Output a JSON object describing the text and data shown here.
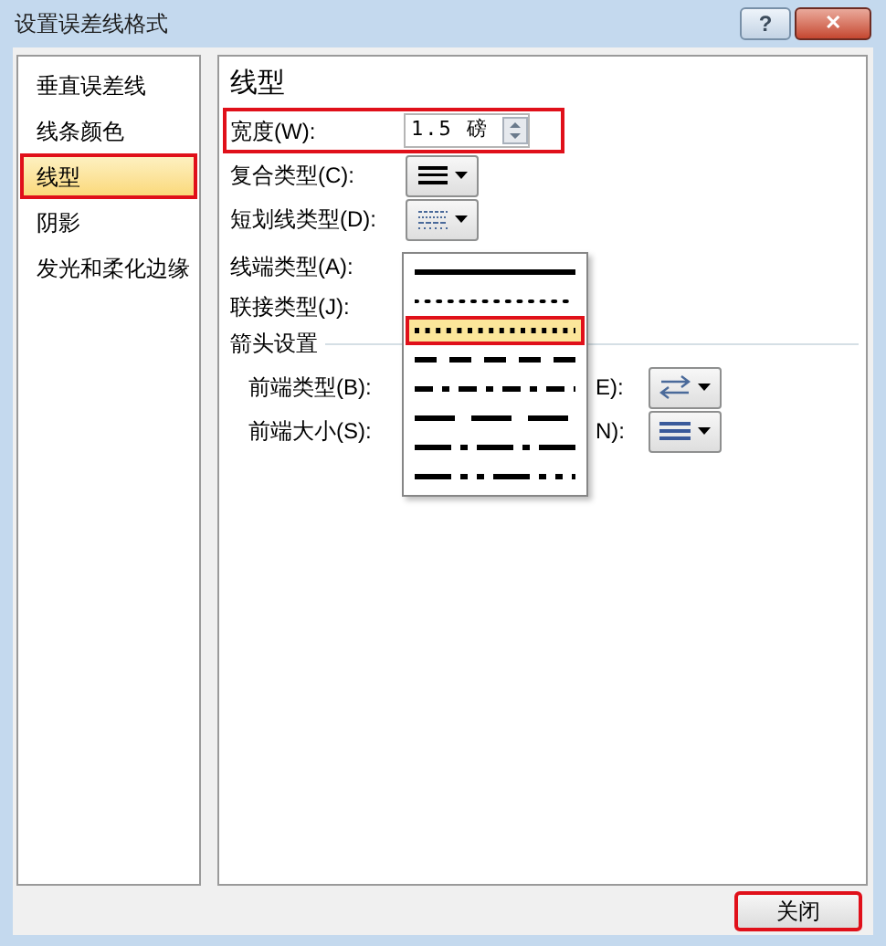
{
  "window": {
    "title": "设置误差线格式",
    "buttons": [
      "?",
      "✕"
    ]
  },
  "sidebar": {
    "items": [
      {
        "label": "垂直误差线",
        "selected": false,
        "highlighted": false
      },
      {
        "label": "线条颜色",
        "selected": false,
        "highlighted": false
      },
      {
        "label": "线型",
        "selected": true,
        "highlighted": true
      },
      {
        "label": "阴影",
        "selected": false,
        "highlighted": false
      },
      {
        "label": "发光和柔化边缘",
        "selected": false,
        "highlighted": false
      }
    ]
  },
  "panel": {
    "heading": "线型",
    "width": {
      "label": "宽度(W):",
      "value": "1.5 磅",
      "highlighted": true
    },
    "compound_type": {
      "label": "复合类型(C):"
    },
    "dash_type": {
      "label": "短划线类型(D):",
      "expanded": true,
      "options": [
        {
          "kind": "solid",
          "selected": false,
          "highlighted": false
        },
        {
          "kind": "round-dot",
          "selected": false,
          "highlighted": false
        },
        {
          "kind": "square-dot",
          "selected": true,
          "highlighted": true
        },
        {
          "kind": "dash",
          "selected": false,
          "highlighted": false
        },
        {
          "kind": "dash-dot",
          "selected": false,
          "highlighted": false
        },
        {
          "kind": "long-dash",
          "selected": false,
          "highlighted": false
        },
        {
          "kind": "long-dash-dot",
          "selected": false,
          "highlighted": false
        },
        {
          "kind": "long-dash-dot-dot",
          "selected": false,
          "highlighted": false
        }
      ]
    },
    "cap_type": {
      "label": "线端类型(A):"
    },
    "join_type": {
      "label": "联接类型(J):"
    },
    "arrow_settings": {
      "heading": "箭头设置",
      "begin_type": {
        "label": "前端类型(B):"
      },
      "end_type": {
        "label": "E):"
      },
      "begin_size": {
        "label": "前端大小(S):"
      },
      "end_size": {
        "label": "N):"
      }
    }
  },
  "close_button": {
    "label": "关闭",
    "highlighted": true
  }
}
